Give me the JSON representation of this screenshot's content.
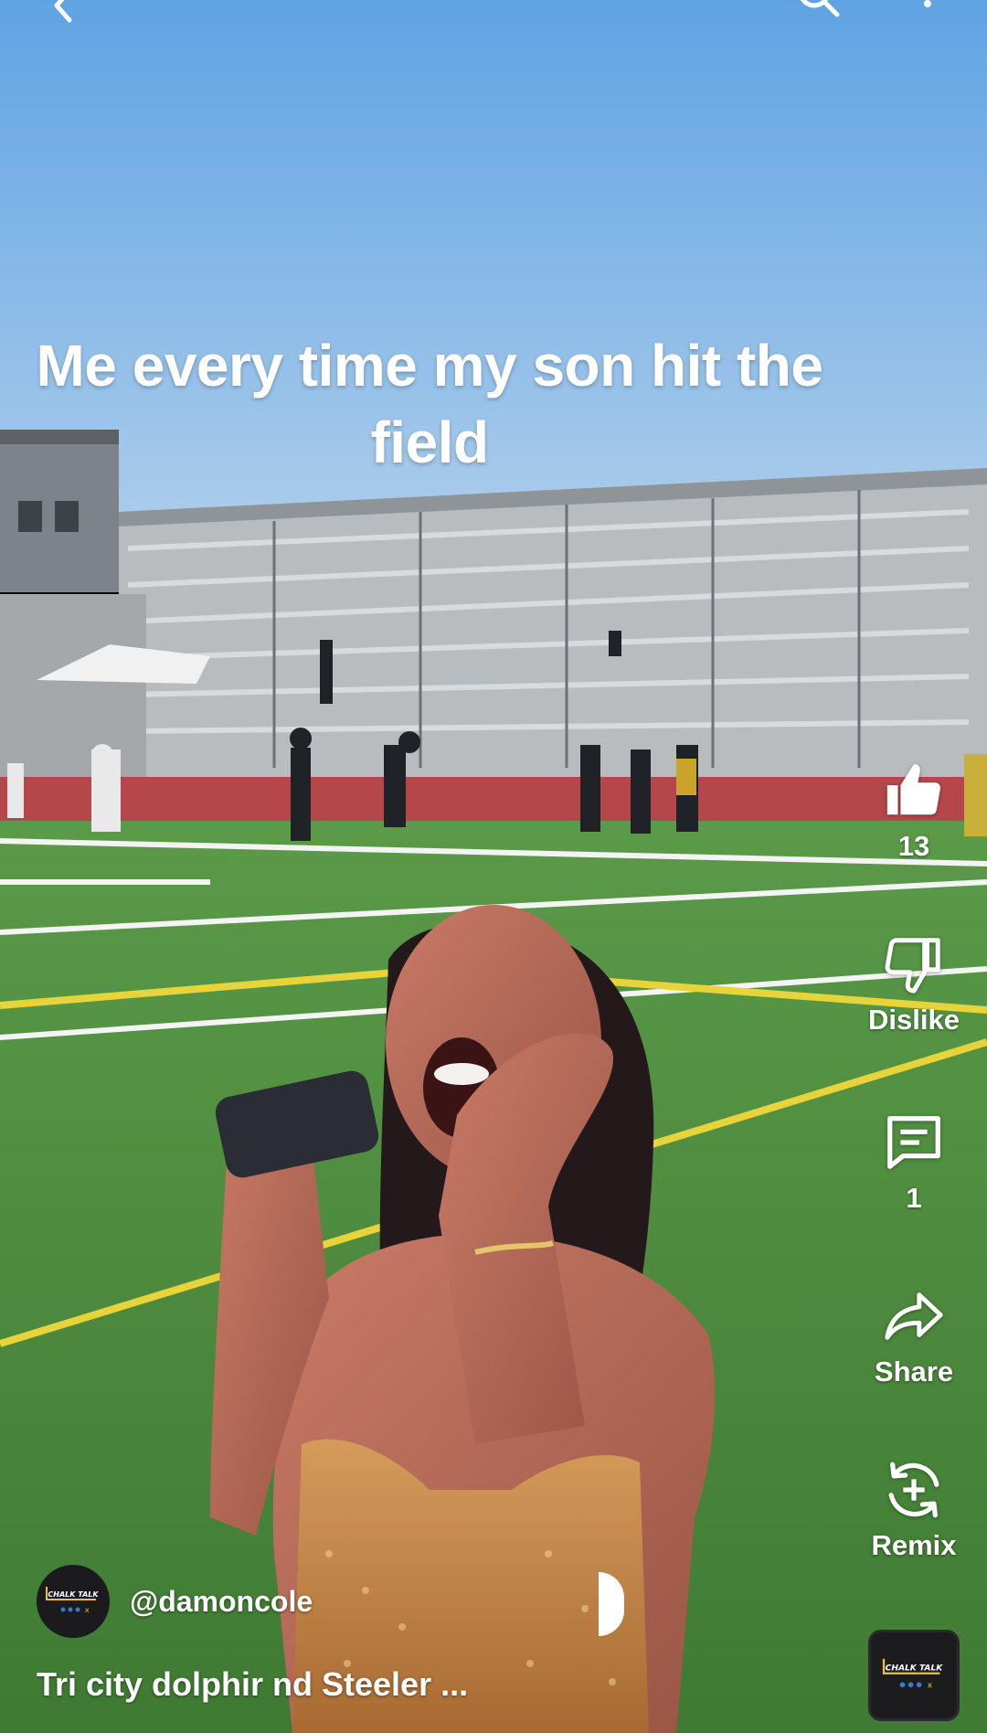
{
  "top_bar": {
    "back_icon": "chevron-left-icon",
    "search_icon": "search-icon",
    "more_icon": "more-vertical-icon"
  },
  "caption": {
    "line1": "Me every time my son hit the",
    "line2": "field"
  },
  "actions": {
    "like": {
      "icon": "thumbs-up-icon",
      "label": "13"
    },
    "dislike": {
      "icon": "thumbs-down-icon",
      "label": "Dislike"
    },
    "comment": {
      "icon": "comment-icon",
      "label": "1"
    },
    "share": {
      "icon": "share-icon",
      "label": "Share"
    },
    "remix": {
      "icon": "remix-icon",
      "label": "Remix"
    }
  },
  "channel": {
    "handle": "@damoncole",
    "avatar_logo_text": "CHALK TALK"
  },
  "video": {
    "title": "Tri city dolphir                          nd Steeler ..."
  },
  "sound_thumb": {
    "logo_text": "CHALK TALK"
  },
  "colors": {
    "sky_top": "#6aaae6",
    "sky_bottom": "#a7c9ea",
    "turf": "#4e8a3d",
    "track": "#b5474a",
    "field_yellow": "#e7d43a",
    "text": "#ffffff"
  }
}
